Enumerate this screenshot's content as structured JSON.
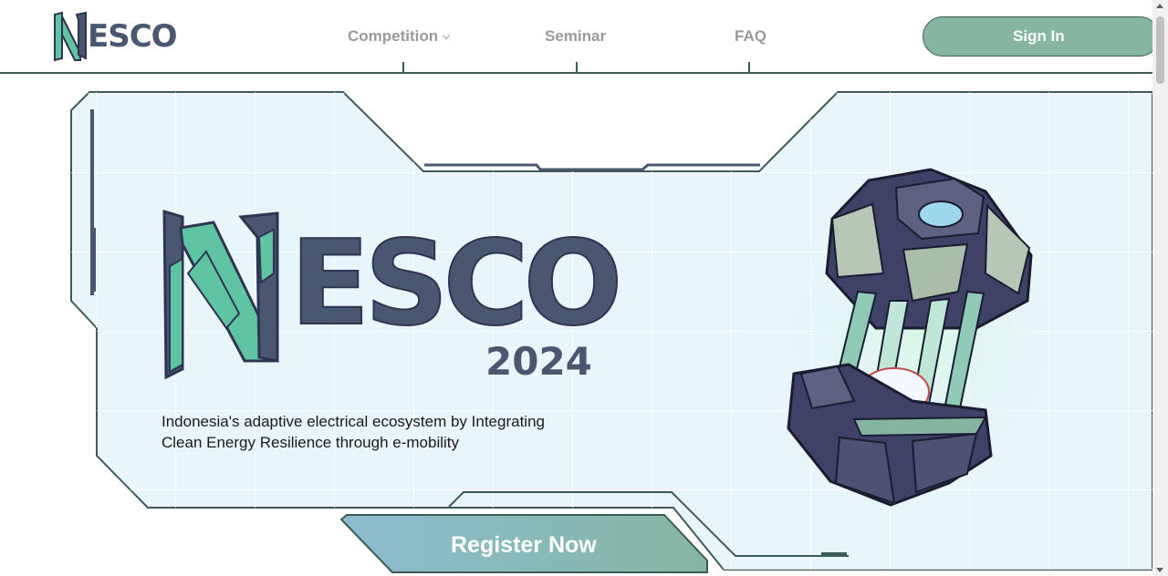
{
  "header": {
    "logo_text": "ESCO",
    "nav": [
      {
        "label": "Competition"
      },
      {
        "label": "Seminar"
      },
      {
        "label": "FAQ"
      }
    ],
    "signin_label": "Sign In"
  },
  "hero": {
    "title": "ESCO",
    "year": "2024",
    "tagline_line1": "Indonesia's adaptive electrical ecosystem by Integrating",
    "tagline_line2": "Clean Energy Resilience through e-mobility",
    "register_label": "Register Now"
  },
  "colors": {
    "accent_green": "#86b6a2",
    "teal_logo": "#5fc4a4",
    "slate_text": "#4a5770",
    "panel_bg": "#e8f5fb",
    "outline": "#3e5a58"
  },
  "icons": [
    "nesco-logo-icon",
    "chevron-down-icon",
    "energy-capsule-icon"
  ]
}
